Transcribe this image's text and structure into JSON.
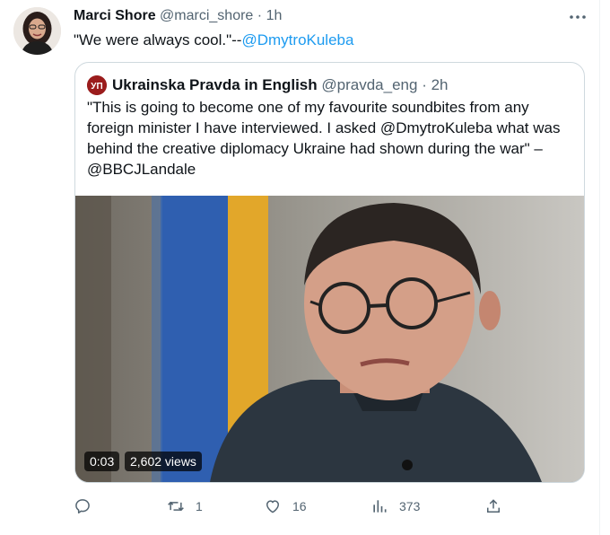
{
  "tweet": {
    "author_name": "Marci Shore",
    "handle": "@marci_shore",
    "separator": "·",
    "time": "1h",
    "text_prefix": "\"We were always cool.\"--",
    "mention": "@DmytroKuleba"
  },
  "quoted": {
    "author_name": "Ukrainska Pravda in English",
    "handle": "@pravda_eng",
    "separator": "·",
    "time": "2h",
    "logo_text": "УП",
    "text_lines": [
      "\"This is going to become one of my favourite soundbites from any",
      "foreign minister I have interviewed. I asked @DmytroKuleba what was",
      "behind the creative diplomacy Ukraine had shown during the war\" –",
      "@BBCJLandale"
    ],
    "video": {
      "duration": "0:03",
      "views": "2,602 views"
    }
  },
  "actions": {
    "replies": "",
    "retweets": "1",
    "likes": "16",
    "views": "373"
  },
  "colors": {
    "accent": "#1d9bf0",
    "muted": "#536471",
    "border": "#cfd9de"
  }
}
